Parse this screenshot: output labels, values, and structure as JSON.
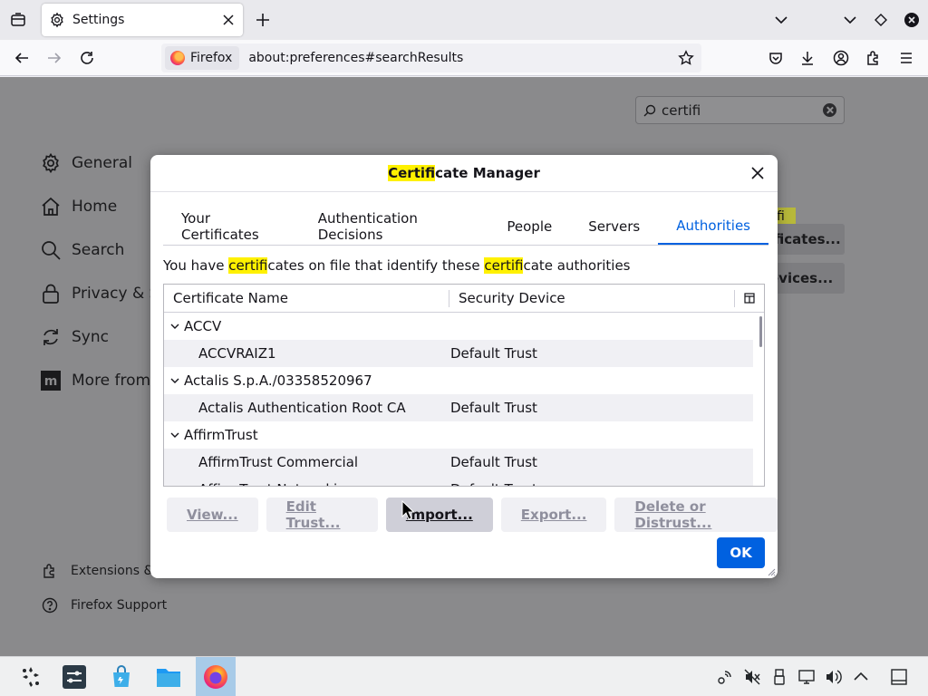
{
  "browser": {
    "tab_title": "Settings",
    "identity_label": "Firefox",
    "url": "about:preferences#searchResults"
  },
  "page": {
    "search_query": "certifi",
    "categories": [
      {
        "label": "General",
        "icon": "gear-icon"
      },
      {
        "label": "Home",
        "icon": "home-icon"
      },
      {
        "label": "Search",
        "icon": "search-icon"
      },
      {
        "label": "Privacy & Se",
        "icon": "lock-icon"
      },
      {
        "label": "Sync",
        "icon": "sync-icon"
      },
      {
        "label": "More from M",
        "icon": "mozilla-icon"
      }
    ],
    "footer_links": [
      {
        "label": "Extensions & T",
        "icon": "puzzle-icon"
      },
      {
        "label": "Firefox Support",
        "icon": "help-icon"
      }
    ],
    "bg_highlight": "fi",
    "bg_buttons": [
      "ificates...",
      "evices..."
    ]
  },
  "dialog": {
    "title_highlight": "Certifi",
    "title_rest": "cate Manager",
    "tabs": [
      "Your Certificates",
      "Authentication Decisions",
      "People",
      "Servers",
      "Authorities"
    ],
    "active_tab": "Authorities",
    "description": {
      "part1": "You have ",
      "hl1": "certifi",
      "part2": "cates on file that identify these ",
      "hl2": "certifi",
      "part3": "cate authorities"
    },
    "columns": {
      "name": "Certificate Name",
      "device": "Security Device"
    },
    "groups": [
      {
        "name": "ACCV",
        "certs": [
          {
            "name": "ACCVRAIZ1",
            "device": "Default Trust"
          }
        ]
      },
      {
        "name": "Actalis S.p.A./03358520967",
        "certs": [
          {
            "name": "Actalis Authentication Root CA",
            "device": "Default Trust"
          }
        ]
      },
      {
        "name": "AffirmTrust",
        "certs": [
          {
            "name": "AffirmTrust Commercial",
            "device": "Default Trust"
          },
          {
            "name": "AffirmTrust Networking",
            "device": "Default Trust"
          }
        ]
      }
    ],
    "buttons": {
      "view": "View...",
      "edit_trust": "Edit Trust...",
      "import": "Import...",
      "export": "Export...",
      "delete": "Delete or Distrust...",
      "ok": "OK"
    }
  },
  "colors": {
    "accent": "#0061e0",
    "highlight": "#fff100"
  }
}
